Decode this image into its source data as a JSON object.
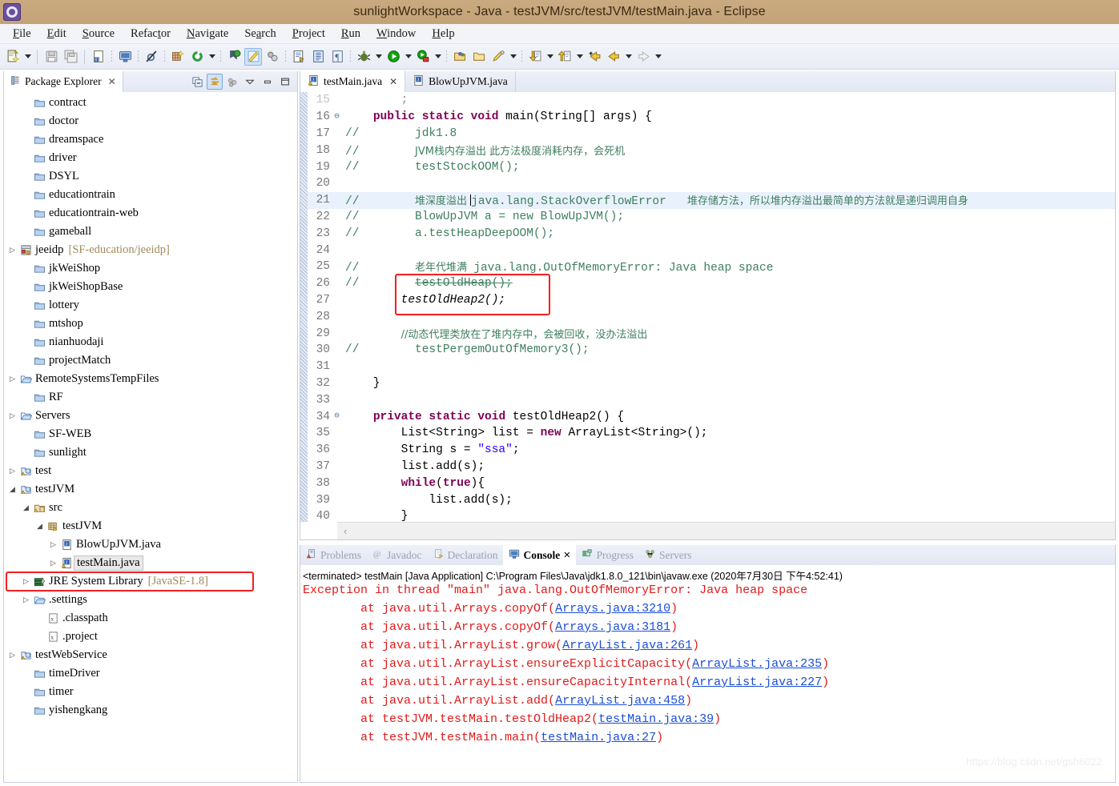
{
  "window": {
    "title": "sunlightWorkspace - Java - testJVM/src/testJVM/testMain.java - Eclipse",
    "logo_icon": "eclipse-gear-icon"
  },
  "menubar": {
    "items": [
      {
        "label": "File"
      },
      {
        "label": "Edit"
      },
      {
        "label": "Source"
      },
      {
        "label": "Refactor"
      },
      {
        "label": "Navigate"
      },
      {
        "label": "Search"
      },
      {
        "label": "Project"
      },
      {
        "label": "Run"
      },
      {
        "label": "Window"
      },
      {
        "label": "Help"
      }
    ]
  },
  "toolbar": {
    "buttons": [
      "new-wizard-icon",
      "save-icon",
      "save-all-icon",
      "new-java-class-icon",
      "open-console-icon",
      "skip-breakpoints-icon",
      "new-package-icon",
      "refresh-icon",
      "debug-last-icon",
      "java-editor-icon",
      "link-icon",
      "open-type-icon",
      "toggle-markoccurrences-icon",
      "show-whitespace-icon",
      "debug-icon",
      "run-icon",
      "coverage-icon",
      "open-resource-icon",
      "open-folder-icon",
      "edit-icon",
      "next-annotation-icon",
      "previous-annotation-icon",
      "back-icon",
      "forward-prev-icon",
      "forward-icon"
    ]
  },
  "explorer": {
    "tab_label": "Package Explorer",
    "tab_icon": "package-explorer-icon",
    "close_icon": "close-icon",
    "tools": [
      "collapse-all-icon",
      "link-with-editor-icon",
      "view-menu-icon",
      "minimize-icon",
      "maximize-icon"
    ],
    "tree": [
      {
        "label": "contract",
        "icon": "folder-icon",
        "arrow": "none",
        "indent": 1
      },
      {
        "label": "doctor",
        "icon": "folder-icon",
        "arrow": "none",
        "indent": 1
      },
      {
        "label": "dreamspace",
        "icon": "folder-icon",
        "arrow": "none",
        "indent": 1
      },
      {
        "label": "driver",
        "icon": "folder-icon",
        "arrow": "none",
        "indent": 1
      },
      {
        "label": "DSYL",
        "icon": "folder-icon",
        "arrow": "none",
        "indent": 1
      },
      {
        "label": "educationtrain",
        "icon": "folder-icon",
        "arrow": "none",
        "indent": 1
      },
      {
        "label": "educationtrain-web",
        "icon": "folder-icon",
        "arrow": "none",
        "indent": 1
      },
      {
        "label": "gameball",
        "icon": "folder-icon",
        "arrow": "none",
        "indent": 1
      },
      {
        "label": "jeeidp",
        "sub": "[SF-education/jeeidp]",
        "icon": "java-project-icon",
        "arrow": "collapsed",
        "indent": 0
      },
      {
        "label": "jkWeiShop",
        "icon": "folder-icon",
        "arrow": "none",
        "indent": 1
      },
      {
        "label": "jkWeiShopBase",
        "icon": "folder-icon",
        "arrow": "none",
        "indent": 1
      },
      {
        "label": "lottery",
        "icon": "folder-icon",
        "arrow": "none",
        "indent": 1
      },
      {
        "label": "mtshop",
        "icon": "folder-icon",
        "arrow": "none",
        "indent": 1
      },
      {
        "label": "nianhuodaji",
        "icon": "folder-icon",
        "arrow": "none",
        "indent": 1
      },
      {
        "label": "projectMatch",
        "icon": "folder-icon",
        "arrow": "none",
        "indent": 1
      },
      {
        "label": "RemoteSystemsTempFiles",
        "icon": "open-folder-icon",
        "arrow": "collapsed",
        "indent": 0
      },
      {
        "label": "RF",
        "icon": "folder-icon",
        "arrow": "none",
        "indent": 1
      },
      {
        "label": "Servers",
        "icon": "open-folder-icon",
        "arrow": "collapsed",
        "indent": 0
      },
      {
        "label": "SF-WEB",
        "icon": "folder-icon",
        "arrow": "none",
        "indent": 1
      },
      {
        "label": "sunlight",
        "icon": "folder-icon",
        "arrow": "none",
        "indent": 1
      },
      {
        "label": "test",
        "icon": "java-project-warn-icon",
        "arrow": "collapsed",
        "indent": 0
      },
      {
        "label": "testJVM",
        "icon": "java-project-warn-icon",
        "arrow": "expanded",
        "indent": 0
      },
      {
        "label": "src",
        "icon": "source-folder-icon",
        "arrow": "expanded",
        "indent": 1
      },
      {
        "label": "testJVM",
        "icon": "package-icon",
        "arrow": "expanded",
        "indent": 2
      },
      {
        "label": "BlowUpJVM.java",
        "icon": "java-file-icon",
        "arrow": "collapsed",
        "indent": 3
      },
      {
        "label": "testMain.java",
        "icon": "java-file-warn-icon",
        "arrow": "collapsed",
        "indent": 3,
        "selected": true
      },
      {
        "label": "JRE System Library",
        "sub": "[JavaSE-1.8]",
        "icon": "library-icon",
        "arrow": "collapsed",
        "indent": 1,
        "highlighted": true
      },
      {
        "label": ".settings",
        "icon": "open-folder-icon",
        "arrow": "collapsed",
        "indent": 1
      },
      {
        "label": ".classpath",
        "icon": "xml-file-icon",
        "arrow": "none",
        "indent": 2
      },
      {
        "label": ".project",
        "icon": "xml-file-icon",
        "arrow": "none",
        "indent": 2
      },
      {
        "label": "testWebService",
        "icon": "java-project-warn-icon",
        "arrow": "collapsed",
        "indent": 0
      },
      {
        "label": "timeDriver",
        "icon": "folder-icon",
        "arrow": "none",
        "indent": 1
      },
      {
        "label": "timer",
        "icon": "folder-icon",
        "arrow": "none",
        "indent": 1
      },
      {
        "label": "yishengkang",
        "icon": "folder-icon",
        "arrow": "none",
        "indent": 1
      }
    ]
  },
  "editor": {
    "tabs": [
      {
        "label": "testMain.java",
        "icon": "java-file-warn-icon",
        "active": true,
        "closable": true
      },
      {
        "label": "BlowUpJVM.java",
        "icon": "java-file-icon",
        "active": false,
        "closable": false
      }
    ],
    "lines": [
      {
        "num": "15",
        "fold": "",
        "partial": true,
        "segments": [
          {
            "t": "        ",
            "c": "pl"
          },
          {
            "t": ";",
            "c": "pl"
          }
        ]
      },
      {
        "num": "16",
        "fold": "e",
        "segments": [
          {
            "t": "    ",
            "c": "pl"
          },
          {
            "t": "public static void ",
            "c": "kw"
          },
          {
            "t": "main(String[] args) {",
            "c": "pl"
          }
        ]
      },
      {
        "num": "17",
        "fold": "",
        "segments": [
          {
            "t": "//        jdk1.8",
            "c": "cm"
          }
        ]
      },
      {
        "num": "18",
        "fold": "",
        "segments": [
          {
            "t": "//        ",
            "c": "cm"
          },
          {
            "t": "JVM栈内存溢出 此方法极度消耗内存，会死机",
            "c": "cm cjk"
          }
        ]
      },
      {
        "num": "19",
        "fold": "",
        "segments": [
          {
            "t": "//        testStockOOM();",
            "c": "cm"
          }
        ]
      },
      {
        "num": "20",
        "fold": "",
        "segments": []
      },
      {
        "num": "21",
        "fold": "",
        "highlight": true,
        "caret_after": 1,
        "segments": [
          {
            "t": "//        ",
            "c": "cm"
          },
          {
            "t": "堆深度溢出 ",
            "c": "cm cjk"
          },
          {
            "t": "java.",
            "c": "cm"
          },
          {
            "t": "lang.StackOverflowError",
            "c": "cm"
          },
          {
            "t": "   ",
            "c": "cm"
          },
          {
            "t": "堆存储方法，所以堆内存溢出最简单的方法就是递归调用自身",
            "c": "cm cjk"
          }
        ]
      },
      {
        "num": "22",
        "fold": "",
        "segments": [
          {
            "t": "//        BlowUpJVM a = new BlowUpJVM();",
            "c": "cm"
          }
        ]
      },
      {
        "num": "23",
        "fold": "",
        "segments": [
          {
            "t": "//        a.testHeapDeepOOM();",
            "c": "cm"
          }
        ]
      },
      {
        "num": "24",
        "fold": "",
        "segments": []
      },
      {
        "num": "25",
        "fold": "",
        "segments": [
          {
            "t": "//        ",
            "c": "cm"
          },
          {
            "t": "老年代堆满  ",
            "c": "cm cjk"
          },
          {
            "t": "java.lang.OutOfMemoryError: Java heap space",
            "c": "cm"
          }
        ]
      },
      {
        "num": "26",
        "fold": "",
        "segments": [
          {
            "t": "//        ",
            "c": "cm"
          },
          {
            "t": "testOldHeap();",
            "c": "cm strike"
          }
        ]
      },
      {
        "num": "27",
        "fold": "",
        "italic": true,
        "segments": [
          {
            "t": "        testOldHeap2();",
            "c": "pl"
          }
        ]
      },
      {
        "num": "28",
        "fold": "",
        "segments": []
      },
      {
        "num": "29",
        "fold": "",
        "segments": [
          {
            "t": "        ",
            "c": "pl"
          },
          {
            "t": "//动态代理类放在了堆内存中，会被回收，没办法溢出",
            "c": "cm cjk"
          }
        ]
      },
      {
        "num": "30",
        "fold": "",
        "segments": [
          {
            "t": "//        testPergemOutOfMemory3();",
            "c": "cm"
          }
        ]
      },
      {
        "num": "31",
        "fold": "",
        "segments": []
      },
      {
        "num": "32",
        "fold": "",
        "segments": [
          {
            "t": "    }",
            "c": "pl"
          }
        ]
      },
      {
        "num": "33",
        "fold": "",
        "segments": []
      },
      {
        "num": "34",
        "fold": "e",
        "segments": [
          {
            "t": "    ",
            "c": "pl"
          },
          {
            "t": "private static void ",
            "c": "kw"
          },
          {
            "t": "testOldHeap2() {",
            "c": "pl"
          }
        ]
      },
      {
        "num": "35",
        "fold": "",
        "segments": [
          {
            "t": "        List<String> list = ",
            "c": "pl"
          },
          {
            "t": "new ",
            "c": "kw"
          },
          {
            "t": "ArrayList<String>();",
            "c": "pl"
          }
        ]
      },
      {
        "num": "36",
        "fold": "",
        "segments": [
          {
            "t": "        String s = ",
            "c": "pl"
          },
          {
            "t": "\"ssa\"",
            "c": "str"
          },
          {
            "t": ";",
            "c": "pl"
          }
        ]
      },
      {
        "num": "37",
        "fold": "",
        "segments": [
          {
            "t": "        list.add(s);",
            "c": "pl"
          }
        ]
      },
      {
        "num": "38",
        "fold": "",
        "segments": [
          {
            "t": "        ",
            "c": "pl"
          },
          {
            "t": "while",
            "c": "kw"
          },
          {
            "t": "(",
            "c": "pl"
          },
          {
            "t": "true",
            "c": "kw"
          },
          {
            "t": "){",
            "c": "pl"
          }
        ]
      },
      {
        "num": "39",
        "fold": "",
        "segments": [
          {
            "t": "            list.add(s);",
            "c": "pl"
          }
        ]
      },
      {
        "num": "40",
        "fold": "",
        "segments": [
          {
            "t": "        }",
            "c": "pl"
          }
        ]
      }
    ]
  },
  "console": {
    "tabs": [
      {
        "label": "Problems",
        "icon": "problems-icon",
        "active": false
      },
      {
        "label": "Javadoc",
        "icon": "javadoc-icon",
        "active": false
      },
      {
        "label": "Declaration",
        "icon": "declaration-icon",
        "active": false
      },
      {
        "label": "Console",
        "icon": "console-icon",
        "active": true
      },
      {
        "label": "Progress",
        "icon": "progress-icon",
        "active": false
      },
      {
        "label": "Servers",
        "icon": "servers-icon",
        "active": false
      }
    ],
    "close_icon": "close-icon",
    "header": "<terminated> testMain [Java Application] C:\\Program Files\\Java\\jdk1.8.0_121\\bin\\javaw.exe (2020年7月30日 下午4:52:41)",
    "output": [
      {
        "segments": [
          {
            "t": "Exception in thread \"main\" java.lang.OutOfMemoryError: Java heap space",
            "link": false
          }
        ]
      },
      {
        "segments": [
          {
            "t": "        at java.util.Arrays.copyOf(",
            "link": false
          },
          {
            "t": "Arrays.java:3210",
            "link": true
          },
          {
            "t": ")",
            "link": false
          }
        ]
      },
      {
        "segments": [
          {
            "t": "        at java.util.Arrays.copyOf(",
            "link": false
          },
          {
            "t": "Arrays.java:3181",
            "link": true
          },
          {
            "t": ")",
            "link": false
          }
        ]
      },
      {
        "segments": [
          {
            "t": "        at java.util.ArrayList.grow(",
            "link": false
          },
          {
            "t": "ArrayList.java:261",
            "link": true
          },
          {
            "t": ")",
            "link": false
          }
        ]
      },
      {
        "segments": [
          {
            "t": "        at java.util.ArrayList.ensureExplicitCapacity(",
            "link": false
          },
          {
            "t": "ArrayList.java:235",
            "link": true
          },
          {
            "t": ")",
            "link": false
          }
        ]
      },
      {
        "segments": [
          {
            "t": "        at java.util.ArrayList.ensureCapacityInternal(",
            "link": false
          },
          {
            "t": "ArrayList.java:227",
            "link": true
          },
          {
            "t": ")",
            "link": false
          }
        ]
      },
      {
        "segments": [
          {
            "t": "        at java.util.ArrayList.add(",
            "link": false
          },
          {
            "t": "ArrayList.java:458",
            "link": true
          },
          {
            "t": ")",
            "link": false
          }
        ]
      },
      {
        "segments": [
          {
            "t": "        at testJVM.testMain.testOldHeap2(",
            "link": false
          },
          {
            "t": "testMain.java:39",
            "link": true
          },
          {
            "t": ")",
            "link": false
          }
        ]
      },
      {
        "segments": [
          {
            "t": "        at testJVM.testMain.main(",
            "link": false
          },
          {
            "t": "testMain.java:27",
            "link": true
          },
          {
            "t": ")",
            "link": false
          }
        ]
      }
    ]
  },
  "watermark": "https://blog.csdn.net/gsh6022",
  "colors": {
    "titlebar": "#c6a87c",
    "highlight_box": "#f41f1f",
    "error_text": "#e01b1b",
    "link_text": "#1b4ed8",
    "keyword": "#7f0055",
    "comment": "#3f7f5f",
    "string": "#2a00ff"
  }
}
